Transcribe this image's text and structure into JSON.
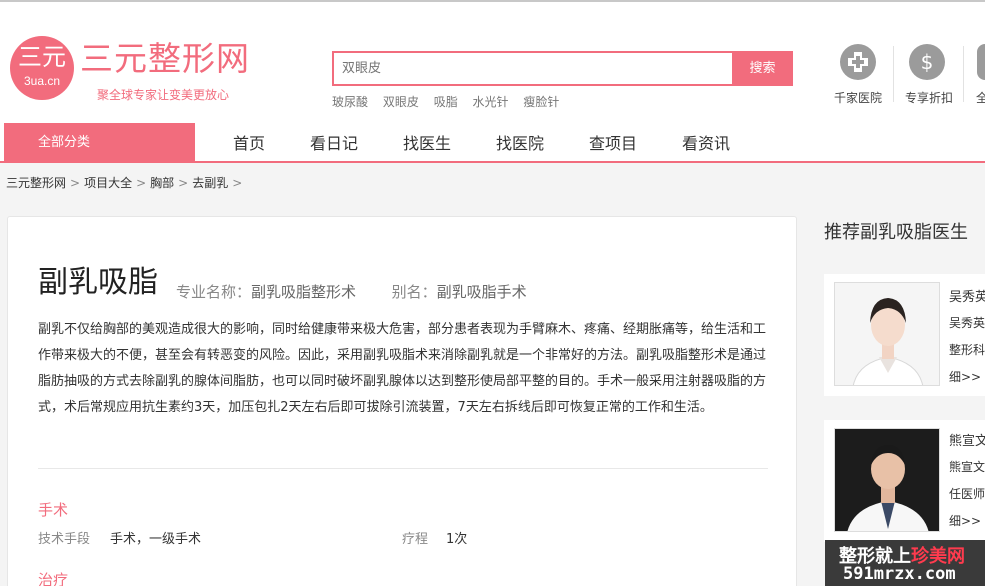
{
  "header": {
    "logo_text": "三元",
    "logo_domain": "3ua.cn",
    "site_name": "三元整形网",
    "slogan": "聚全球专家让变美更放心"
  },
  "search": {
    "placeholder": "双眼皮",
    "button_label": "搜索",
    "hot_words": [
      "玻尿酸",
      "双眼皮",
      "吸脂",
      "水光针",
      "瘦脸针"
    ]
  },
  "header_links": [
    {
      "label": "千家医院",
      "icon": "hospital-cross-icon"
    },
    {
      "label": "专享折扣",
      "icon": "dollar-discount-icon"
    },
    {
      "label": "全",
      "icon": "partial-icon"
    }
  ],
  "nav": {
    "all_categories": "全部分类",
    "items": [
      "首页",
      "看日记",
      "找医生",
      "找医院",
      "查项目",
      "看资讯"
    ]
  },
  "breadcrumb": {
    "items": [
      "三元整形网",
      "项目大全",
      "胸部",
      "去副乳"
    ],
    "separator": ">"
  },
  "project": {
    "title": "副乳吸脂",
    "pro_name_label": "专业名称：",
    "pro_name": "副乳吸脂整形术",
    "alias_label": "别名：",
    "alias": "副乳吸脂手术",
    "description": "副乳不仅给胸部的美观造成很大的影响，同时给健康带来极大危害，部分患者表现为手臂麻木、疼痛、经期胀痛等，给生活和工作带来极大的不便，甚至会有转恶变的风险。因此，采用副乳吸脂术来消除副乳就是一个非常好的方法。副乳吸脂整形术是通过脂肪抽吸的方式去除副乳的腺体间脂肪，也可以同时破坏副乳腺体以达到整形使局部平整的目的。手术一般采用注射器吸脂的方式，术后常规应用抗生素约3天，加压包扎2天左右后即可拔除引流装置，7天左右拆线后即可恢复正常的工作和生活。",
    "surgery_section": "手术",
    "tech_label": "技术手段",
    "tech_value": "手术，一级手术",
    "course_label": "疗程",
    "course_value": "1次",
    "treatment_section": "治疗"
  },
  "sidebar": {
    "title": "推荐副乳吸脂医生",
    "doctors": [
      {
        "line1": "吴秀英",
        "line2": "吴秀英",
        "line3": "整形科",
        "line4": "细>>"
      },
      {
        "line1": "熊宣文",
        "line2": "熊宣文",
        "line3": "任医师",
        "line4": "细>>"
      }
    ]
  },
  "watermark": {
    "line1_a": "整形就上",
    "line1_b": "珍美网",
    "line2": "591mrzx.com"
  },
  "colors": {
    "accent": "#f26c7d",
    "icon_gray": "#9b9b9b",
    "watermark_bg": "#3a3a3a"
  }
}
